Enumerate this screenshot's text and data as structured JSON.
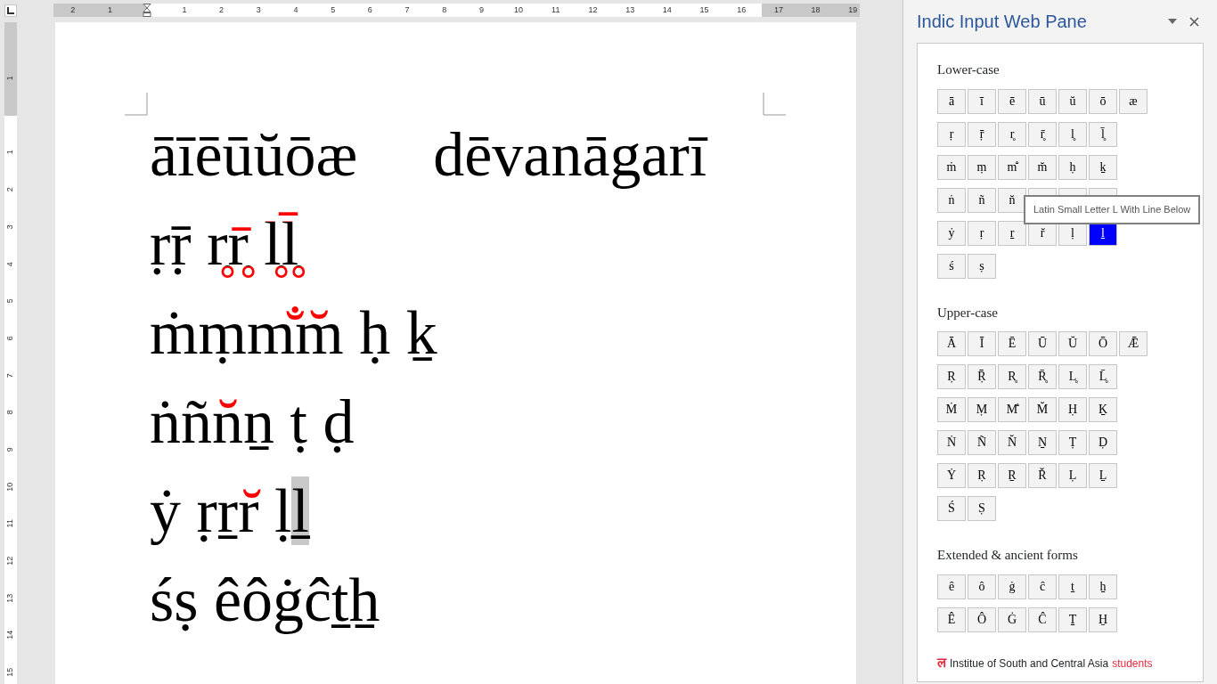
{
  "ruler": {
    "horizontal_labels": [
      "2",
      "1",
      "1",
      "2",
      "3",
      "4",
      "5",
      "6",
      "7",
      "8",
      "9",
      "10",
      "11",
      "12",
      "13",
      "14",
      "15",
      "16",
      "17",
      "18",
      "19"
    ],
    "vertical_labels": [
      "1",
      "1",
      "2",
      "3",
      "4",
      "5",
      "6",
      "7",
      "8",
      "9",
      "10",
      "11",
      "12",
      "13",
      "14",
      "15"
    ]
  },
  "document": {
    "lines": [
      {
        "groups": [
          [
            {
              "text": "āīēūŭōæ",
              "kind": "plain"
            }
          ],
          [
            {
              "text": "dēvanāgarī",
              "kind": "plain"
            }
          ]
        ]
      },
      {
        "groups": [
          [
            {
              "text": "ṛṝ ",
              "kind": "plain"
            },
            {
              "text": "r̥r̥̄ ",
              "kind": "red_marks"
            },
            {
              "text": "l̥l̥̄",
              "kind": "red_marks_tall"
            }
          ]
        ]
      },
      {
        "groups": [
          [
            {
              "text": "ṁṃ",
              "kind": "plain"
            },
            {
              "text": "m̐m̆",
              "kind": "red_marks"
            },
            {
              "text": " ḥ ḵ",
              "kind": "plain"
            }
          ]
        ]
      },
      {
        "groups": [
          [
            {
              "text": "ṅñ",
              "kind": "plain"
            },
            {
              "text": "n̆",
              "kind": "red_marks"
            },
            {
              "text": "ṉ ṭ ḍ",
              "kind": "plain"
            }
          ]
        ]
      },
      {
        "groups": [
          [
            {
              "text": "ẏ ṛṟ",
              "kind": "plain"
            },
            {
              "text": "r̆",
              "kind": "red_marks"
            },
            {
              "text": " ḷ",
              "kind": "plain"
            },
            {
              "text": "ḻ",
              "kind": "selected"
            }
          ]
        ]
      },
      {
        "groups": [
          [
            {
              "text": "śṣ êôġĉṯẖ",
              "kind": "plain"
            }
          ]
        ]
      }
    ]
  },
  "pane": {
    "title": "Indic Input Web Pane",
    "sections": [
      {
        "title": "Lower-case",
        "rows": [
          [
            {
              "char": "ā",
              "selected": false
            },
            {
              "char": "ī",
              "selected": false
            },
            {
              "char": "ē",
              "selected": false
            },
            {
              "char": "ū",
              "selected": false
            },
            {
              "char": "ŭ",
              "selected": false
            },
            {
              "char": "ō",
              "selected": false
            },
            {
              "char": "æ",
              "selected": false
            }
          ],
          [
            {
              "char": "ṛ",
              "selected": false
            },
            {
              "char": "ṝ",
              "selected": false
            },
            {
              "char": "r̥",
              "selected": false
            },
            {
              "char": "r̥̄",
              "selected": false
            },
            {
              "char": "l̥",
              "selected": false
            },
            {
              "char": "l̥̄",
              "selected": false
            }
          ],
          [
            {
              "char": "ṁ",
              "selected": false
            },
            {
              "char": "ṃ",
              "selected": false
            },
            {
              "char": "m̐",
              "selected": false
            },
            {
              "char": "m̆",
              "selected": false
            },
            {
              "char": "ḥ",
              "selected": false
            },
            {
              "char": "ḵ",
              "selected": false
            }
          ],
          [
            {
              "char": "ṅ",
              "selected": false
            },
            {
              "char": "ñ",
              "selected": false
            },
            {
              "char": "n̆",
              "selected": false
            },
            {
              "selected": false
            },
            {
              "selected": false
            },
            {
              "selected": false
            }
          ],
          [
            {
              "char": "ẏ",
              "selected": false
            },
            {
              "char": "ṛ",
              "selected": false
            },
            {
              "char": "ṟ",
              "selected": false
            },
            {
              "char": "r̆",
              "selected": false
            },
            {
              "char": "ḷ",
              "selected": false
            },
            {
              "char": "ḻ",
              "selected": true
            }
          ],
          [
            {
              "char": "ś",
              "selected": false
            },
            {
              "char": "ṣ",
              "selected": false
            }
          ]
        ]
      },
      {
        "title": "Upper-case",
        "rows": [
          [
            {
              "char": "Ā",
              "selected": false
            },
            {
              "char": "Ī",
              "selected": false
            },
            {
              "char": "Ē",
              "selected": false
            },
            {
              "char": "Ū",
              "selected": false
            },
            {
              "char": "Ŭ",
              "selected": false
            },
            {
              "char": "Ō",
              "selected": false
            },
            {
              "char": "Ǣ",
              "selected": false
            }
          ],
          [
            {
              "char": "Ṛ",
              "selected": false
            },
            {
              "char": "Ṝ",
              "selected": false
            },
            {
              "char": "R̥",
              "selected": false
            },
            {
              "char": "R̥̄",
              "selected": false
            },
            {
              "char": "L̥",
              "selected": false
            },
            {
              "char": "L̥̄",
              "selected": false
            }
          ],
          [
            {
              "char": "Ṁ",
              "selected": false
            },
            {
              "char": "Ṃ",
              "selected": false
            },
            {
              "char": "M̐",
              "selected": false
            },
            {
              "char": "M̆",
              "selected": false
            },
            {
              "char": "Ḥ",
              "selected": false
            },
            {
              "char": "Ḵ",
              "selected": false
            }
          ],
          [
            {
              "char": "Ṅ",
              "selected": false
            },
            {
              "char": "Ñ",
              "selected": false
            },
            {
              "char": "N̆",
              "selected": false
            },
            {
              "char": "Ṉ",
              "selected": false
            },
            {
              "char": "Ṭ",
              "selected": false
            },
            {
              "char": "Ḍ",
              "selected": false
            }
          ],
          [
            {
              "char": "Ẏ",
              "selected": false
            },
            {
              "char": "Ṛ",
              "selected": false
            },
            {
              "char": "Ṟ",
              "selected": false
            },
            {
              "char": "Ř",
              "selected": false
            },
            {
              "char": "Ḷ",
              "selected": false
            },
            {
              "char": "Ḻ",
              "selected": false
            }
          ],
          [
            {
              "char": "Ś",
              "selected": false
            },
            {
              "char": "Ṣ",
              "selected": false
            }
          ]
        ]
      },
      {
        "title": "Extended & ancient forms",
        "rows": [
          [
            {
              "char": "ê",
              "selected": false
            },
            {
              "char": "ô",
              "selected": false
            },
            {
              "char": "ġ",
              "selected": false
            },
            {
              "char": "ĉ",
              "selected": false
            },
            {
              "char": "ṯ",
              "selected": false
            },
            {
              "char": "ẖ",
              "selected": false
            }
          ],
          [
            {
              "char": "Ê",
              "selected": false
            },
            {
              "char": "Ô",
              "selected": false
            },
            {
              "char": "Ġ",
              "selected": false
            },
            {
              "char": "Ĉ",
              "selected": false
            },
            {
              "char": "Ṯ",
              "selected": false
            },
            {
              "char": "H̱",
              "selected": false
            }
          ]
        ]
      }
    ],
    "tooltip": {
      "text": "Latin Small Letter L With Line Below"
    },
    "footer": {
      "logo": "ल",
      "text": "Institue of South and Central Asia",
      "link": "students"
    }
  }
}
